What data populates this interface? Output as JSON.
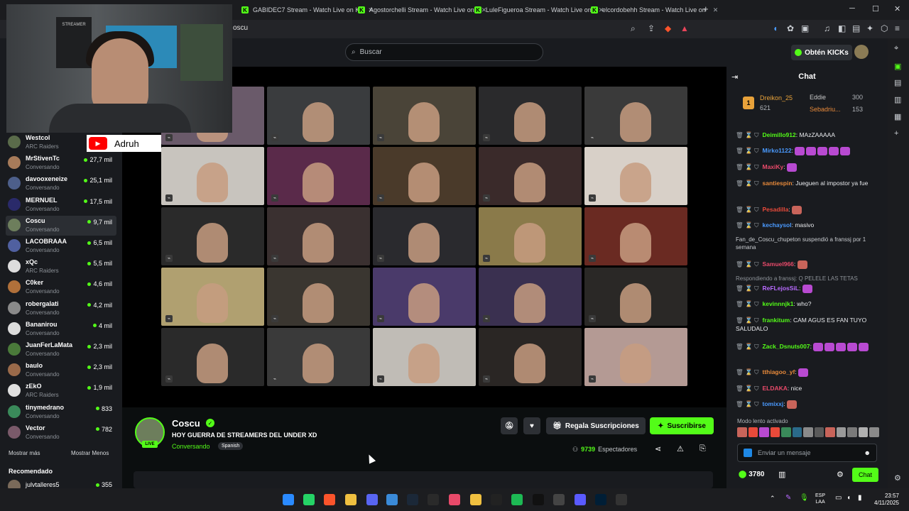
{
  "browser": {
    "tabs": [
      {
        "label": "GABIDEC7 Stream - Watch Live on Ki"
      },
      {
        "label": "Agostorchelli Stream - Watch Live on"
      },
      {
        "label": "LuleFigueroa Stream - Watch Live on"
      },
      {
        "label": "elcordobehh Stream - Watch Live on"
      }
    ],
    "new_tab": "+",
    "url": "oscu",
    "window_controls": {
      "minimize": "─",
      "maximize": "☐",
      "close": "✕"
    }
  },
  "header": {
    "search_placeholder": "Buscar",
    "kicks_button": "Obtén KICKs"
  },
  "webcam": {
    "youtube_name": "Adruh",
    "poster_text": "STREAMER"
  },
  "sidebar": {
    "channels": [
      {
        "name": "Westcol",
        "sub": "ARC Raiders",
        "viewers": "",
        "color": "#5a6b4a"
      },
      {
        "name": "MrStivenTc",
        "sub": "Conversando",
        "viewers": "27,7 mil",
        "color": "#a77b5a"
      },
      {
        "name": "davooxeneize",
        "sub": "Conversando",
        "viewers": "25,1 mil",
        "color": "#4d5f8a"
      },
      {
        "name": "MERNUEL",
        "sub": "Conversando",
        "viewers": "17,5 mil",
        "color": "#2a2a6a"
      },
      {
        "name": "Coscu",
        "sub": "Conversando",
        "viewers": "9,7 mil",
        "color": "#6d7e5c"
      },
      {
        "name": "LACOBRAAA",
        "sub": "Conversando",
        "viewers": "6,5 mil",
        "color": "#5060a0"
      },
      {
        "name": "xQc",
        "sub": "ARC Raiders",
        "viewers": "5,5 mil",
        "color": "#dddddd"
      },
      {
        "name": "C0ker",
        "sub": "Conversando",
        "viewers": "4,6 mil",
        "color": "#b0703a"
      },
      {
        "name": "robergalati",
        "sub": "Conversando",
        "viewers": "4,2 mil",
        "color": "#8a8a8a"
      },
      {
        "name": "Bananirou",
        "sub": "Conversando",
        "viewers": "4 mil",
        "color": "#dcdcdc"
      },
      {
        "name": "JuanFerLaMata",
        "sub": "Conversando",
        "viewers": "2,3 mil",
        "color": "#4a7a3a"
      },
      {
        "name": "baulo",
        "sub": "Conversando",
        "viewers": "2,3 mil",
        "color": "#9a6a4a"
      },
      {
        "name": "zEkO",
        "sub": "ARC Raiders",
        "viewers": "1,9 mil",
        "color": "#e0e0e0"
      },
      {
        "name": "tinymedrano",
        "sub": "Conversando",
        "viewers": "833",
        "color": "#3a8a5a"
      },
      {
        "name": "Vector",
        "sub": "Conversando",
        "viewers": "782",
        "color": "#7a5a6a"
      }
    ],
    "show_more": "Mostrar más",
    "show_less": "Mostrar Menos",
    "recommended_label": "Recomendado",
    "recommended_first": {
      "name": "julvtalleres5",
      "viewers": "355"
    }
  },
  "video": {
    "cells": [
      "#6a5a6a",
      "#3a3c3e",
      "#4a4438",
      "#2a2a2c",
      "#3a3a3a",
      "#c8c4be",
      "#5a2a4a",
      "#4a3a2a",
      "#3a2a2a",
      "#d8d0c8",
      "#2a2a2a",
      "#3a3030",
      "#2a2a2e",
      "#8a7a4a",
      "#6a2a22",
      "#b0a070",
      "#3a3630",
      "#4a3a6a",
      "#3a3050",
      "#2a2826",
      "#2a2a2a",
      "#3a3a3a",
      "#c0bcb6",
      "#2a2624",
      "#b49a94"
    ]
  },
  "stream": {
    "streamer": "Coscu",
    "title": "HOY GUERRA DE STREAMERS DEL UNDER XD",
    "category": "Conversando",
    "language": "Spanish",
    "live": "LIVE",
    "gift_subs": "Regala Suscripciones",
    "subscribe": "Suscribirse",
    "viewers_count": "9739",
    "viewers_label": "Espectadores"
  },
  "chat": {
    "title": "Chat",
    "leaderboard": [
      {
        "name": "Dreikon_25",
        "value": "621",
        "color": "#e8a23a"
      },
      {
        "name": "Eddie",
        "value": "300",
        "color": "#c8c8c8"
      },
      {
        "name": "Sebadriu...",
        "value": "153",
        "color": "#e88a3a"
      }
    ],
    "messages": [
      {
        "user": "Deimillo912",
        "color": "#53fc18",
        "text": ": MAzZAAAAA"
      },
      {
        "user": "Mirko1122",
        "color": "#4a9aff",
        "text": ":"
      },
      {
        "user": "MaxiKy",
        "color": "#e84a6a",
        "text": ":"
      },
      {
        "user": "santiespin",
        "color": "#e88a3a",
        "text": ": Jueguen al impostor ya fue"
      },
      {
        "user": "Pesadilla",
        "color": "#e84a3a",
        "text": ":"
      },
      {
        "user": "kechaysol",
        "color": "#4a9aff",
        "text": ": masivo"
      },
      {
        "user": "Samuel966",
        "color": "#e84a6a",
        "text": ":"
      },
      {
        "user": "ReFLejosSiL",
        "color": "#b86aff",
        "text": ":"
      },
      {
        "user": "kevinnnjk1",
        "color": "#53fc18",
        "text": ": who?"
      },
      {
        "user": "frankitum",
        "color": "#53fc18",
        "text": ": CAM AGUS ES FAN TUYO SALUDALO"
      },
      {
        "user": "Zack_Dsnuts007",
        "color": "#53fc18",
        "text": ":"
      },
      {
        "user": "tthiagoo_yf",
        "color": "#e88a3a",
        "text": ":"
      },
      {
        "user": "ELDAKA",
        "color": "#e84a6a",
        "text": ": nice"
      },
      {
        "user": "tomixxj",
        "color": "#4a9aff",
        "text": ":"
      }
    ],
    "system_suspend": "Fan_de_Coscu_chupeton suspendió a franssj por 1 semana",
    "reply_label": "Respondiendo a franssj: Q PELELE LAS TETAS",
    "slow_mode": "Modo lento activado",
    "input_placeholder": "Enviar un mensaje",
    "points": "3780",
    "send_label": "Chat"
  },
  "taskbar": {
    "lang": "ESP",
    "lang_sub": "LAA",
    "time": "23:57",
    "date": "4/11/2025"
  }
}
